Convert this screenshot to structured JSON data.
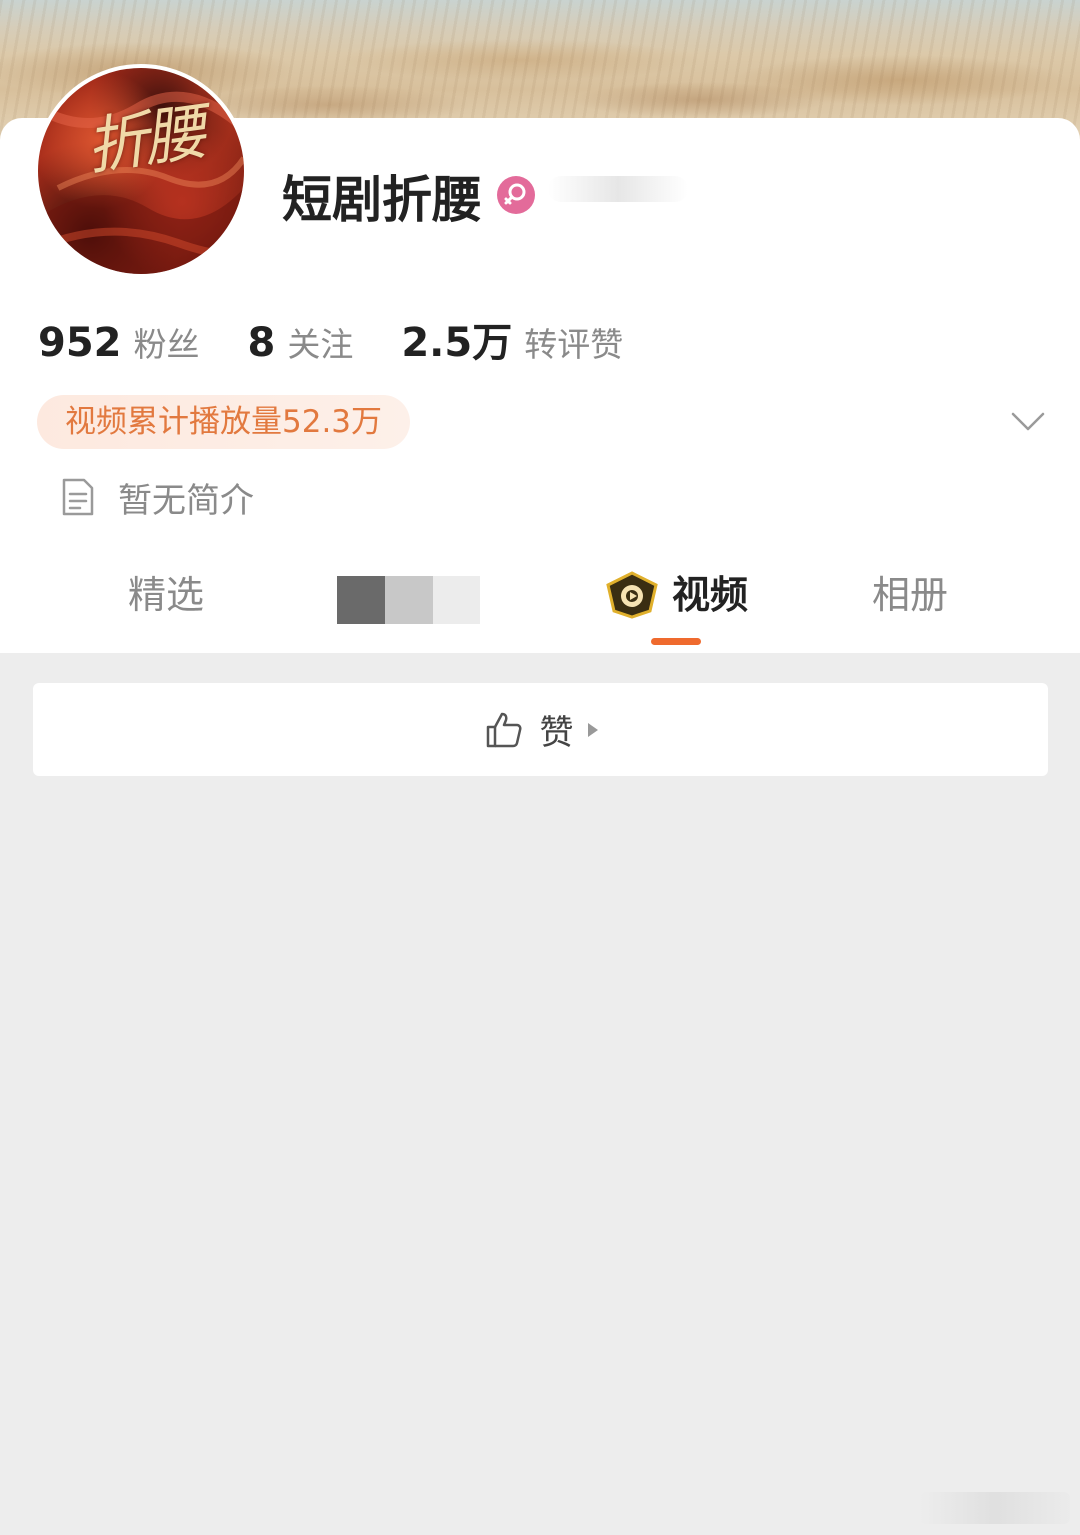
{
  "profile": {
    "avatar_text": "折腰",
    "name": "短剧折腰",
    "gender_icon": "female-icon"
  },
  "stats": [
    {
      "number": "952",
      "label": "粉丝"
    },
    {
      "number": "8",
      "label": "关注"
    },
    {
      "number": "2.5万",
      "label": "转评赞"
    }
  ],
  "play_count": "视频累计播放量52.3万",
  "intro": "暂无简介",
  "tabs": {
    "featured": "精选",
    "video": "视频",
    "album": "相册",
    "active": "视频"
  },
  "like_bar": {
    "label": "赞"
  },
  "colors": {
    "accent": "#ef6a2e",
    "pill_text": "#e2793f",
    "pill_bg": "#fde9df",
    "gender_badge": "#e36b9a",
    "page_bg": "#ededed"
  }
}
